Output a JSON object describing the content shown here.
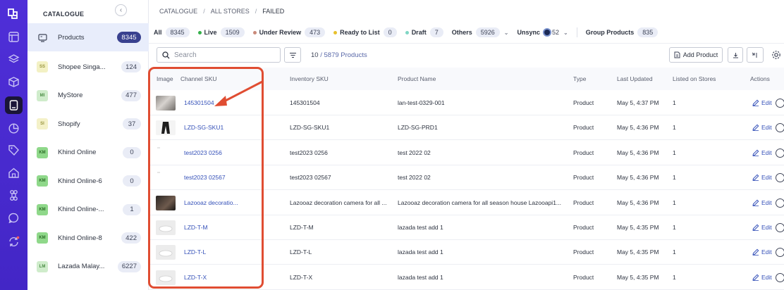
{
  "sidebar": {
    "title": "CATALOGUE",
    "products": {
      "label": "Products",
      "count": "8345"
    },
    "stores": [
      {
        "code": "SS",
        "label": "Shopee Singa...",
        "count": "124",
        "bg": "#f3f1c4",
        "fg": "#9a9640"
      },
      {
        "code": "MI",
        "label": "MyStore",
        "count": "477",
        "bg": "#cfeccb",
        "fg": "#4c8e46"
      },
      {
        "code": "SI",
        "label": "Shopify",
        "count": "37",
        "bg": "#f4f1c8",
        "fg": "#9a9640"
      },
      {
        "code": "KM",
        "label": "Khind Online",
        "count": "0",
        "bg": "#8fd88a",
        "fg": "#2f6e2a"
      },
      {
        "code": "KM",
        "label": "Khind Online-6",
        "count": "0",
        "bg": "#8fd88a",
        "fg": "#2f6e2a"
      },
      {
        "code": "KM",
        "label": "Khind Online-...",
        "count": "1",
        "bg": "#8fd88a",
        "fg": "#2f6e2a"
      },
      {
        "code": "KM",
        "label": "Khind Online-8",
        "count": "422",
        "bg": "#8fd88a",
        "fg": "#2f6e2a"
      },
      {
        "code": "LM",
        "label": "Lazada Malay...",
        "count": "6227",
        "bg": "#cfeccb",
        "fg": "#4c8e46"
      }
    ]
  },
  "breadcrumb": [
    "CATALOGUE",
    "ALL STORES",
    "FAILED"
  ],
  "tabs": {
    "all": {
      "label": "All",
      "count": "8345"
    },
    "live": {
      "label": "Live",
      "count": "1509",
      "color": "#35b04a"
    },
    "review": {
      "label": "Under Review",
      "count": "473",
      "color": "#c98a7a"
    },
    "ready": {
      "label": "Ready to List",
      "count": "0",
      "color": "#e8c02c"
    },
    "draft": {
      "label": "Draft",
      "count": "7",
      "color": "#7fd6c4"
    },
    "others": {
      "label": "Others",
      "count": "5926"
    },
    "unsync": {
      "label": "Unsync",
      "count": "52"
    },
    "group": {
      "label": "Group Products",
      "count": "835"
    }
  },
  "toolbar": {
    "search_placeholder": "Search",
    "count_main": "10",
    "count_sub": " / 5879 Products",
    "add_product": "Add Product"
  },
  "table": {
    "headers": [
      "Image",
      "Channel SKU",
      "Inventory SKU",
      "Product Name",
      "Type",
      "Last Updated",
      "Listed on Stores",
      "Actions"
    ],
    "edit_label": "Edit",
    "rows": [
      {
        "channel_sku": "145301504",
        "inventory_sku": "145301504",
        "name": "lan-test-0329-001",
        "type": "Product",
        "updated": "May 5, 4:37 PM",
        "listed": "1",
        "img": "room"
      },
      {
        "channel_sku": "LZD-SG-SKU1",
        "inventory_sku": "LZD-SG-SKU1",
        "name": "LZD-SG-PRD1",
        "type": "Product",
        "updated": "May 5, 4:36 PM",
        "listed": "1",
        "img": "pants"
      },
      {
        "channel_sku": "test2023 0256",
        "inventory_sku": "test2023 0256",
        "name": "test 2022 02",
        "type": "Product",
        "updated": "May 5, 4:36 PM",
        "listed": "1",
        "img": "blank"
      },
      {
        "channel_sku": "test2023 02567",
        "inventory_sku": "test2023 02567",
        "name": "test 2022 02",
        "type": "Product",
        "updated": "May 5, 4:36 PM",
        "listed": "1",
        "img": "blank"
      },
      {
        "channel_sku": "Lazooaz decoratio...",
        "inventory_sku": "Lazooaz decoration camera for all ...",
        "name": "Lazooaz decoration camera for all season house Lazooapi1...",
        "type": "Product",
        "updated": "May 5, 4:36 PM",
        "listed": "1",
        "img": "dark"
      },
      {
        "channel_sku": "LZD-T-M",
        "inventory_sku": "LZD-T-M",
        "name": "lazada test add 1",
        "type": "Product",
        "updated": "May 5, 4:35 PM",
        "listed": "1",
        "img": "light"
      },
      {
        "channel_sku": "LZD-T-L",
        "inventory_sku": "LZD-T-L",
        "name": "lazada test add 1",
        "type": "Product",
        "updated": "May 5, 4:35 PM",
        "listed": "1",
        "img": "light"
      },
      {
        "channel_sku": "LZD-T-X",
        "inventory_sku": "LZD-T-X",
        "name": "lazada test add 1",
        "type": "Product",
        "updated": "May 5, 4:35 PM",
        "listed": "1",
        "img": "light"
      }
    ]
  }
}
